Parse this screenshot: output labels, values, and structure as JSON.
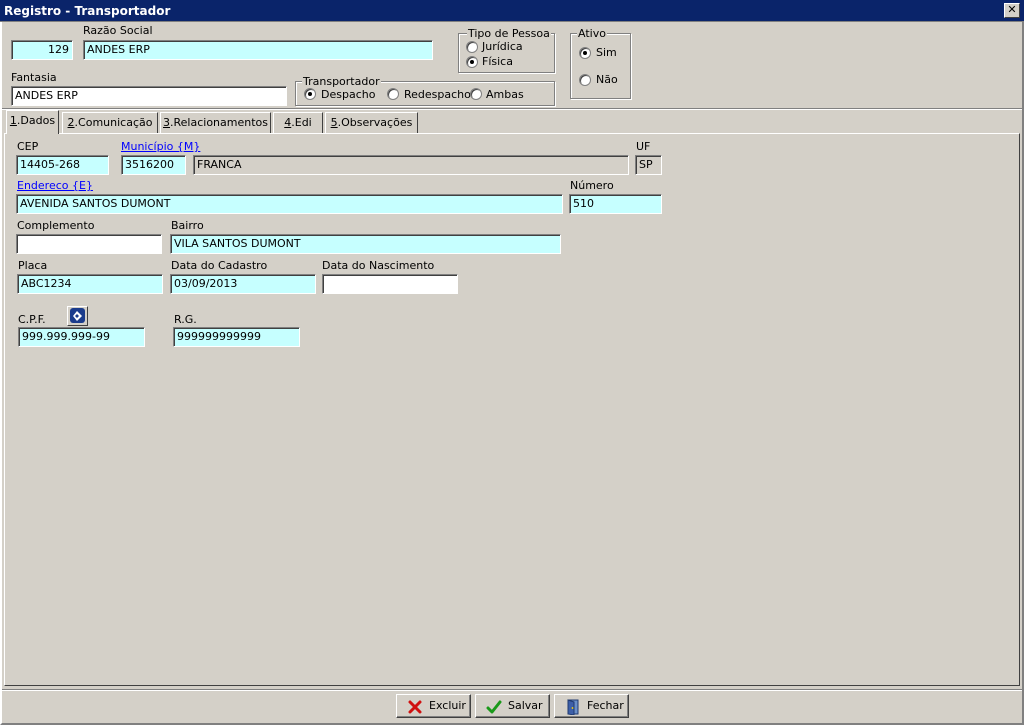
{
  "window": {
    "title": "Registro - Transportador",
    "close_glyph": "✕"
  },
  "header": {
    "code_value": "129",
    "razao_social_label": "Razão Social",
    "razao_social_value": "ANDES ERP",
    "fantasia_label": "Fantasia",
    "fantasia_value": "ANDES ERP",
    "tipo_pessoa": {
      "legend": "Tipo de Pessoa",
      "options": [
        "Jurídica",
        "Física"
      ],
      "selected": "Física"
    },
    "ativo": {
      "legend": "Ativo",
      "options": [
        "Sim",
        "Não"
      ],
      "selected": "Sim"
    },
    "transportador": {
      "legend": "Transportador",
      "options": [
        "Despacho",
        "Redespacho",
        "Ambas"
      ],
      "selected": "Despacho"
    }
  },
  "tabs": [
    {
      "key": "1",
      "label": "Dados"
    },
    {
      "key": "2",
      "label": "Comunicação"
    },
    {
      "key": "3",
      "label": "Relacionamentos"
    },
    {
      "key": "4",
      "label": "Edi"
    },
    {
      "key": "5",
      "label": "Observações"
    }
  ],
  "active_tab": "Dados",
  "form": {
    "cep_label": "CEP",
    "cep_value": "14405-268",
    "municipio_label": "Município {M}",
    "municipio_code": "3516200",
    "municipio_name": "FRANCA",
    "uf_label": "UF",
    "uf_value": "SP",
    "endereco_label": "Endereco {E}",
    "endereco_value": "AVENIDA SANTOS DUMONT",
    "numero_label": "Número",
    "numero_value": "510",
    "complemento_label": "Complemento",
    "complemento_value": "",
    "bairro_label": "Bairro",
    "bairro_value": "VILA SANTOS DUMONT",
    "placa_label": "Placa",
    "placa_value": "ABC1234",
    "data_cadastro_label": "Data do Cadastro",
    "data_cadastro_value": "03/09/2013",
    "data_nascimento_label": "Data do Nascimento",
    "data_nascimento_value": "",
    "cpf_label": "C.P.F.",
    "cpf_value": "999.999.999-99",
    "rg_label": "R.G.",
    "rg_value": "999999999999"
  },
  "buttons": {
    "excluir": "Excluir",
    "salvar": "Salvar",
    "fechar": "Fechar"
  },
  "icons": {
    "receita": "receita-federal-icon",
    "excluir": "red-x-icon",
    "salvar": "green-check-icon",
    "fechar": "door-icon"
  },
  "colors": {
    "field_bg": "#c6ffff",
    "titlebar": "#0a246a",
    "window_bg": "#d4d0c8",
    "link": "#0000ff"
  }
}
